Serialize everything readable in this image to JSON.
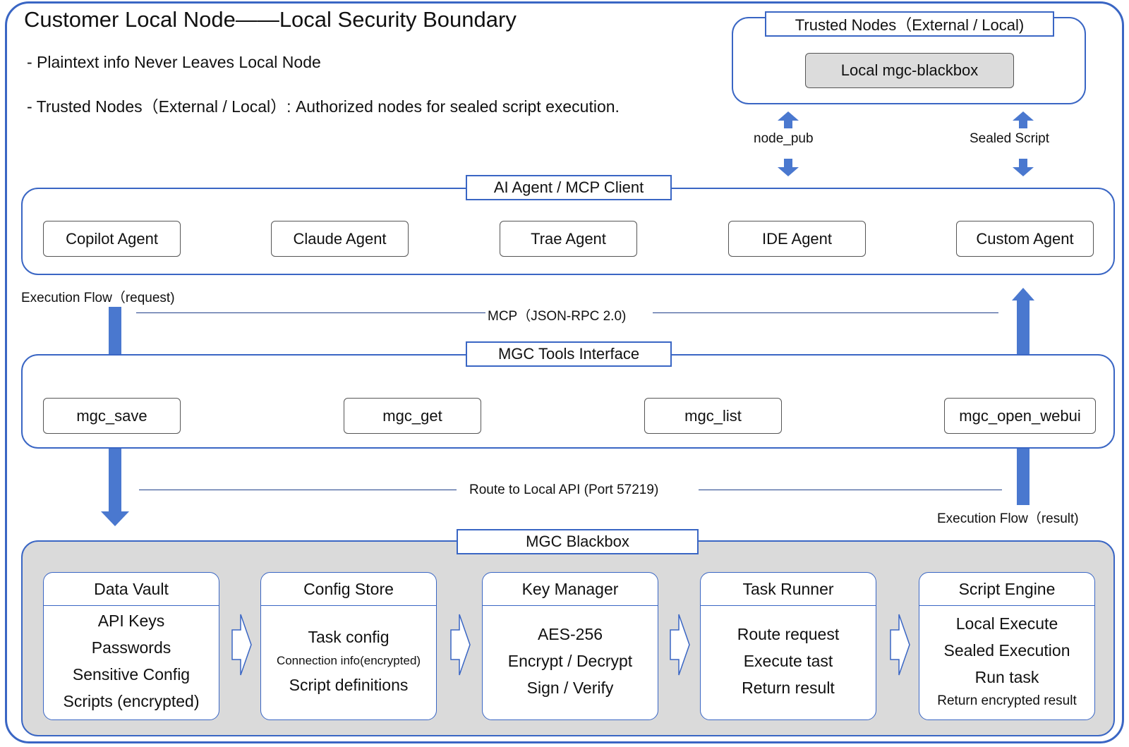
{
  "boundary": {
    "title": "Customer Local Node——Local Security Boundary",
    "notes": [
      "- Plaintext info Never Leaves Local Node",
      "- Trusted Nodes（External / Local）: Authorized nodes for sealed script execution."
    ]
  },
  "trusted_nodes": {
    "tag": "Trusted Nodes（External / Local)",
    "node": "Local mgc-blackbox"
  },
  "links": {
    "node_pub": "node_pub",
    "sealed_script": "Sealed Script"
  },
  "agents_panel": {
    "tag": "AI Agent / MCP Client",
    "agents": [
      "Copilot Agent",
      "Claude Agent",
      "Trae Agent",
      "IDE Agent",
      "Custom Agent"
    ]
  },
  "flows": {
    "request": "Execution Flow（request)",
    "mcp": "MCP（JSON-RPC 2.0)",
    "route": "Route to Local API (Port 57219)",
    "result": "Execution Flow（result)"
  },
  "tools_panel": {
    "tag": "MGC Tools Interface",
    "tools": [
      "mgc_save",
      "mgc_get",
      "mgc_list",
      "mgc_open_webui"
    ]
  },
  "blackbox": {
    "tag": "MGC Blackbox",
    "modules": [
      {
        "title": "Data Vault",
        "lines": [
          "API Keys",
          "Passwords",
          "Sensitive Config",
          "Scripts (encrypted)"
        ]
      },
      {
        "title": "Config Store",
        "lines": [
          "Task config",
          "Connection info(encrypted)",
          "Script definitions"
        ]
      },
      {
        "title": "Key Manager",
        "lines": [
          "AES-256",
          "Encrypt / Decrypt",
          "Sign / Verify"
        ]
      },
      {
        "title": "Task Runner",
        "lines": [
          "Route request",
          "Execute tast",
          "Return result"
        ]
      },
      {
        "title": "Script Engine",
        "lines": [
          "Local Execute",
          "Sealed Execution",
          "Run task",
          "Return encrypted result"
        ]
      }
    ]
  },
  "colors": {
    "accent": "#3a66c4",
    "arrow": "#4a78cf",
    "panel_gray": "#dadada"
  }
}
